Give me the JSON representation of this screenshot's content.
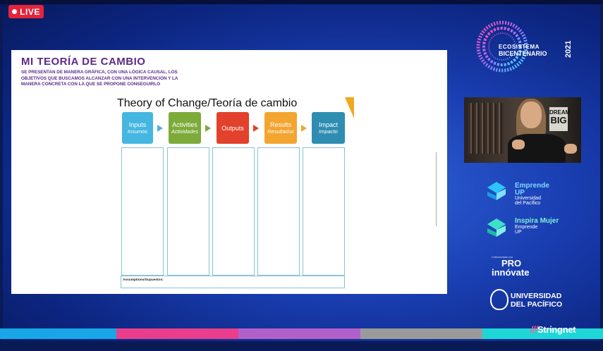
{
  "badge": {
    "live": "LIVE"
  },
  "slide": {
    "title": "MI TEORÍA DE CAMBIO",
    "subtitle": "SE PRESENTAN DE MANERA GRÁFICA, CON UNA LÓGICA CAUSAL, LOS OBJETIVOS QUE BUSCAMOS ALCANZAR CON UNA INTERVENCIÓN Y LA MANERA CONCRETA CON LA QUE SE PROPONE CONSEGUIRLO",
    "diagram_title": "Theory of Change/Teoría de cambio",
    "boxes": [
      {
        "label": "Inputs",
        "sub": "Insumos",
        "color": "#45b6e0"
      },
      {
        "label": "Activities",
        "sub": "Actividades",
        "color": "#7dab3a"
      },
      {
        "label": "Outputs",
        "sub": "",
        "color": "#e2412b"
      },
      {
        "label": "Results",
        "sub": "Resultados",
        "color": "#f3a530"
      },
      {
        "label": "Impact",
        "sub": "Impacto",
        "color": "#2f8db2"
      }
    ],
    "assumptions": "Assumptions/Supuestos:"
  },
  "event": {
    "line1": "ECOSISTEMA",
    "line2": "BICENTENARIO",
    "year": "2021"
  },
  "sponsors": {
    "emprende": {
      "name": "Emprende",
      "sub1": "UP",
      "sub2": "Universidad",
      "sub3": "del Pacífico"
    },
    "inspira": {
      "name": "Inspira Mujer",
      "sub1": "Emprende",
      "sub2": "UP"
    },
    "proinnovate": {
      "top": "Cofinanciado por",
      "line1": "PRO",
      "line2": "innóvate"
    },
    "universidad": {
      "line1": "UNIVERSIDAD",
      "line2": "DEL PACÍFICO"
    }
  },
  "footer": {
    "brand": "Stringnet"
  },
  "colors": {
    "live": "#e5243b",
    "title": "#5b2a86",
    "bar1": "#19a6e6",
    "bar2": "#e83e8c",
    "bar3": "#b260c9",
    "bar4": "#9a9a9a",
    "bar5": "#1fd6d6"
  }
}
